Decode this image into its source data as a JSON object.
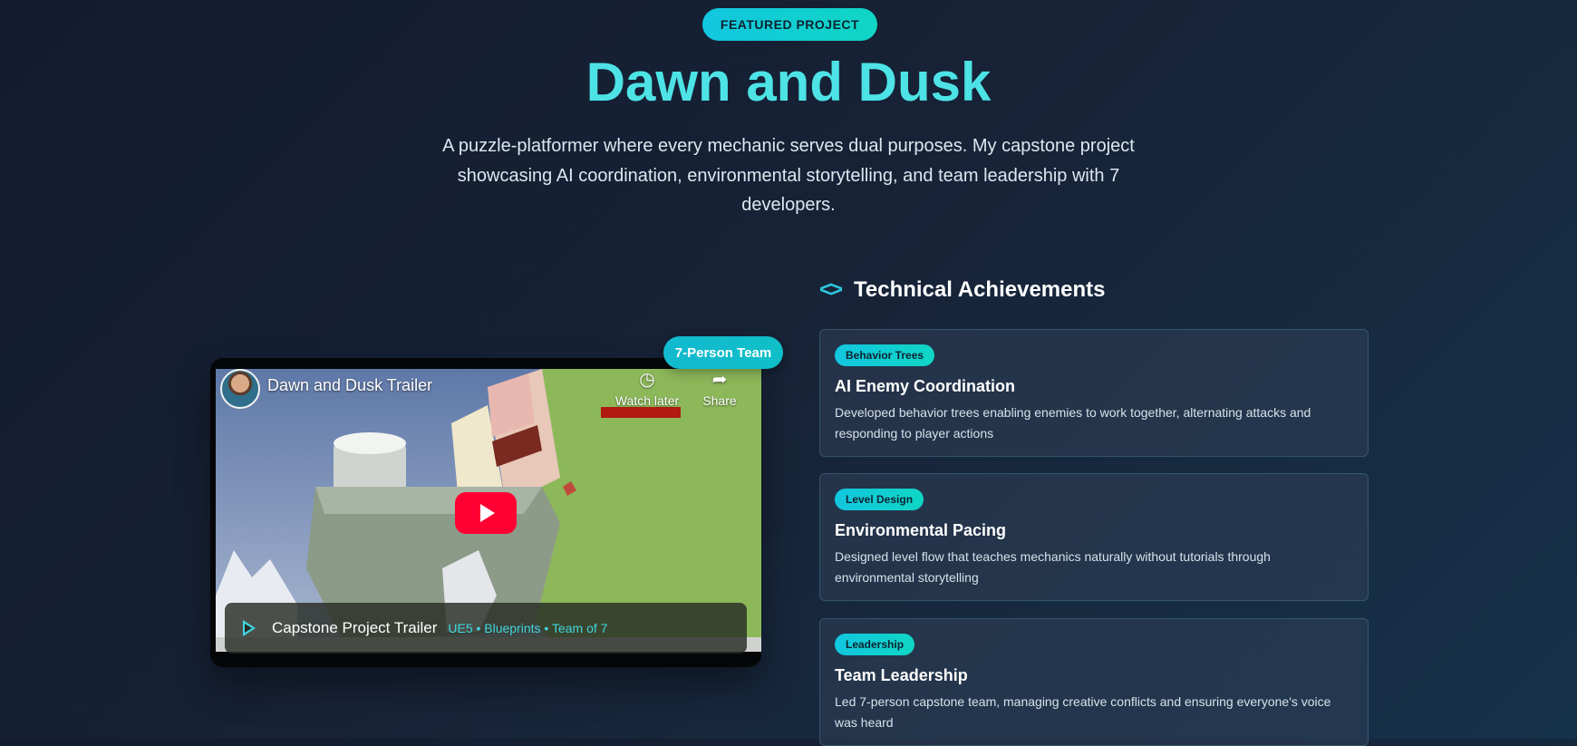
{
  "hero": {
    "badge": "FEATURED PROJECT",
    "title": "Dawn and Dusk",
    "description": "A puzzle-platformer where every mechanic serves dual purposes. My capstone project showcasing AI coordination, environmental storytelling, and team leadership with 7 developers."
  },
  "video": {
    "team_badge": "7-Person Team",
    "yt_title": "Dawn and Dusk Trailer",
    "watch_later": "Watch later",
    "share": "Share",
    "caption_title": "Capstone Project Trailer",
    "caption_meta": "UE5 • Blueprints • Team of 7"
  },
  "achievements": {
    "heading": "Technical Achievements",
    "cards": [
      {
        "tag": "Behavior Trees",
        "title": "AI Enemy Coordination",
        "text": "Developed behavior trees enabling enemies to work together, alternating attacks and responding to player actions"
      },
      {
        "tag": "Level Design",
        "title": "Environmental Pacing",
        "text": "Designed level flow that teaches mechanics naturally without tutorials through environmental storytelling"
      },
      {
        "tag": "Leadership",
        "title": "Team Leadership",
        "text": "Led 7-person capstone team, managing creative conflicts and ensuring everyone's voice was heard"
      }
    ]
  },
  "colors": {
    "accent": "#4de3e6",
    "tag_gradient_start": "#12c6e0",
    "tag_gradient_end": "#0fd6c4",
    "youtube_red": "#ff0033"
  },
  "icons": [
    "code-brackets-icon",
    "play-icon",
    "clock-icon",
    "share-icon",
    "avatar"
  ]
}
